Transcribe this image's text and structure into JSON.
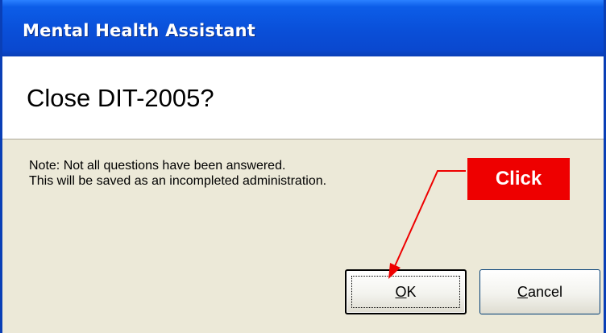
{
  "window": {
    "title": "Mental Health Assistant"
  },
  "dialog": {
    "heading": "Close DIT-2005?",
    "note_line1": "Note: Not all questions have been answered.",
    "note_line2": "This will be saved as an incompleted administration.",
    "ok": {
      "mnemonic": "O",
      "rest": "K"
    },
    "cancel": {
      "mnemonic": "C",
      "rest": "ancel"
    }
  },
  "annotation": {
    "callout_text": "Click",
    "callout_color": "#ee0000"
  },
  "colors": {
    "titlebar": "#0a4fd8",
    "dialog_bg": "#ece9d8",
    "border": "#0a3fb6"
  }
}
